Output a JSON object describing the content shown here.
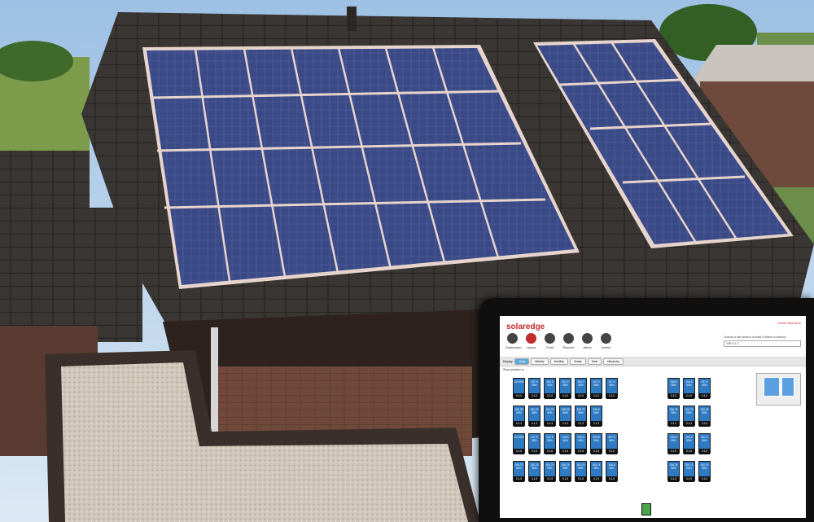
{
  "app": {
    "brand": "solaredge",
    "user_links": "Home  Welcome",
    "nav": [
      {
        "label": "Dashboard",
        "icon": "gauge-icon"
      },
      {
        "label": "Layout",
        "icon": "layout-icon"
      },
      {
        "label": "Chart",
        "icon": "chart-icon"
      },
      {
        "label": "Reports",
        "icon": "reports-icon"
      },
      {
        "label": "Alerts",
        "icon": "alert-icon"
      },
      {
        "label": "Admin",
        "icon": "admin-icon"
      }
    ],
    "site_prompt": "Choose a site (search at least 3 letters to search):",
    "site_value": "GRH 11 C",
    "display_label": "Display:",
    "tabs": [
      "Daily",
      "Weekly",
      "Monthly",
      "Yearly",
      "Total",
      "Hierarchy"
    ],
    "show_toggle": "Show practice ►",
    "axis_letter": "A",
    "panels_left": [
      [
        "210",
        "207.5",
        "200.5",
        "201.5",
        "206.9",
        "207.5",
        "207.5"
      ],
      [
        "208.35",
        "200.75",
        "203.75",
        "208.28",
        "203.75",
        "206.9"
      ],
      [
        "210",
        "227.5",
        "222.5",
        "218.5",
        "205.5",
        "209.8",
        "207.5"
      ],
      [
        "208.75",
        "200.75",
        "203.75",
        "208.75",
        "203.75",
        "208.75",
        "206.8"
      ]
    ],
    "panels_right": [
      [
        "206.5",
        "206.5",
        "207.5"
      ],
      [
        "206.75",
        "200.75",
        "200.75"
      ],
      [
        "206.5",
        "206.5",
        "207.5"
      ],
      [
        "206.75",
        "200.75",
        "200.75"
      ]
    ],
    "panel_pct": "98%",
    "panel_ids": [
      "0.1.0",
      "0.1.3",
      "0.1.6",
      "0.1.9"
    ],
    "inverter_label": "S.E."
  }
}
